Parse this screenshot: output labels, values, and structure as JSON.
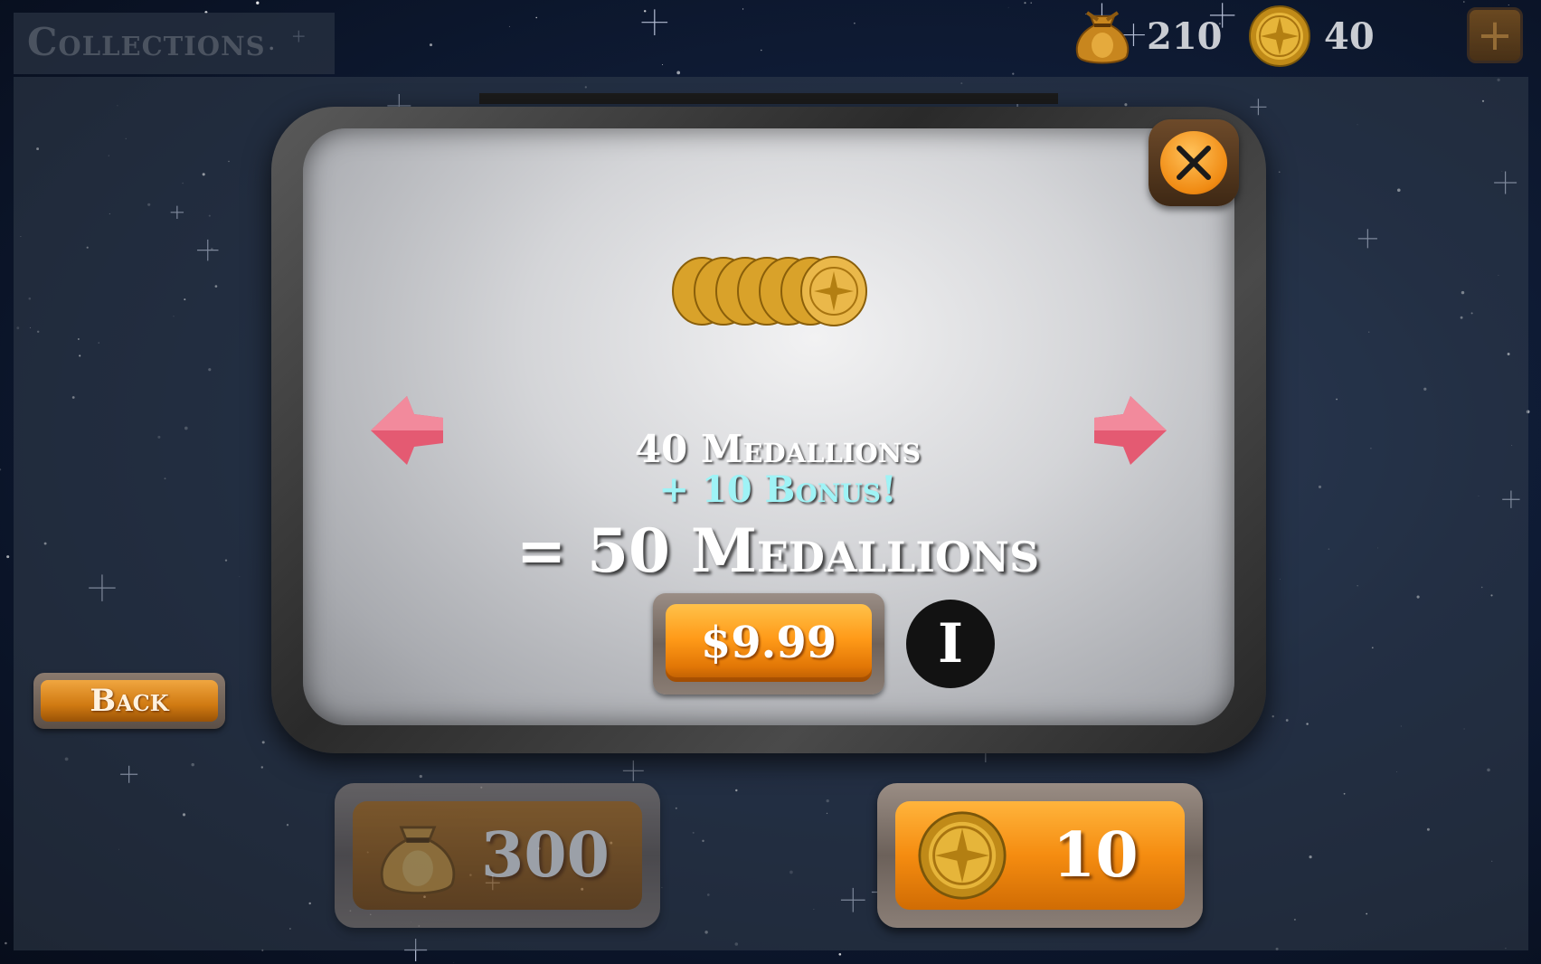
{
  "header": {
    "title": "Collections",
    "bags_count": "210",
    "medallions_count": "40",
    "add_label": "+"
  },
  "modal": {
    "line1": "40 Medallions",
    "line2": "+ 10 Bonus!",
    "line3": "= 50 Medallions",
    "price": "$9.99",
    "info_label": "I",
    "close_icon": "close-icon",
    "coin_icon": "medallion-stack-icon"
  },
  "back_label": "Back",
  "bottom": {
    "bags_button_value": "300",
    "medallions_button_value": "10"
  },
  "colors": {
    "accent_orange": "#ff9a18",
    "bonus_cyan": "#9ff3f6",
    "nav_arrow_pink": "#e2506a"
  }
}
